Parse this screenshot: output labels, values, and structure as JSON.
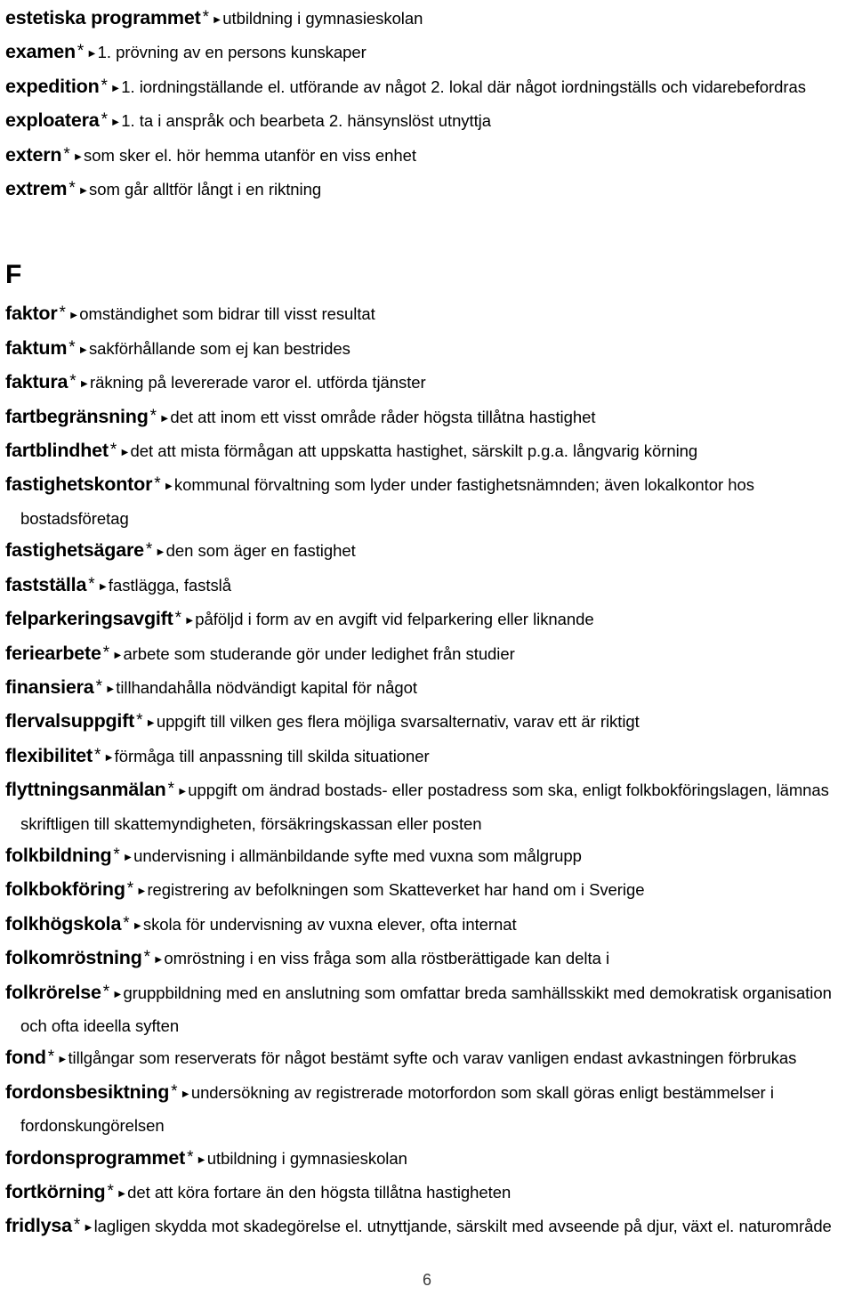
{
  "document": {
    "type": "glossary-page",
    "language": "sv",
    "page_number": "6",
    "marker_star": "*",
    "marker_triangle": "►"
  },
  "entries_before_section": [
    {
      "headword": "estetiska programmet",
      "definition": "utbildning i gymnasieskolan"
    },
    {
      "headword": "examen",
      "definition": "1. prövning av en persons kunskaper"
    },
    {
      "headword": "expedition",
      "definition": "1. iordningställande el. utförande av något 2. lokal där något iordningställs och vidarebefordras"
    },
    {
      "headword": "exploatera",
      "definition": "1. ta i anspråk och bearbeta 2. hänsynslöst utnyttja"
    },
    {
      "headword": "extern",
      "definition": "som sker el. hör hemma utanför en viss enhet"
    },
    {
      "headword": "extrem",
      "definition": "som går alltför långt i en riktning"
    }
  ],
  "section": {
    "letter": "F"
  },
  "entries_after_section": [
    {
      "headword": "faktor",
      "definition": "omständighet som bidrar till visst resultat"
    },
    {
      "headword": "faktum",
      "definition": "sakförhållande som ej kan bestrides"
    },
    {
      "headword": "faktura",
      "definition": "räkning på levererade varor el. utförda tjänster"
    },
    {
      "headword": "fartbegränsning",
      "definition": "det att inom ett visst område råder högsta tillåtna hastighet"
    },
    {
      "headword": "fartblindhet",
      "definition": "det att mista förmågan att uppskatta hastighet, särskilt p.g.a. långvarig körning"
    },
    {
      "headword": "fastighetskontor",
      "definition": "kommunal förvaltning som lyder under fastighetsnämnden; även lokalkontor hos bostadsföretag"
    },
    {
      "headword": "fastighetsägare",
      "definition": "den som äger en fastighet"
    },
    {
      "headword": "fastställa",
      "definition": "fastlägga, fastslå"
    },
    {
      "headword": "felparkeringsavgift",
      "definition": "påföljd i form av en avgift vid felparkering eller liknande"
    },
    {
      "headword": "feriearbete",
      "definition": "arbete som studerande gör under ledighet från studier"
    },
    {
      "headword": "finansiera",
      "definition": "tillhandahålla nödvändigt kapital för något"
    },
    {
      "headword": "flervalsuppgift",
      "definition": "uppgift till vilken ges flera möjliga svarsalternativ, varav ett är riktigt"
    },
    {
      "headword": "flexibilitet",
      "definition": "förmåga till anpassning till skilda situationer"
    },
    {
      "headword": "flyttningsanmälan",
      "definition": "uppgift om ändrad bostads- eller postadress som ska, enligt folkbokföringslagen, lämnas skriftligen till skattemyndigheten, försäkringskassan eller posten"
    },
    {
      "headword": "folkbildning",
      "definition": "undervisning i allmänbildande syfte med vuxna som  målgrupp"
    },
    {
      "headword": "folkbokföring",
      "definition": "registrering av befolkningen som Skatteverket har hand om i Sverige"
    },
    {
      "headword": "folkhögskola",
      "definition": "skola för undervisning av vuxna elever, ofta internat"
    },
    {
      "headword": "folkomröstning",
      "definition": "omröstning i en viss fråga som alla röstberättigade kan delta i"
    },
    {
      "headword": "folkrörelse",
      "definition": "gruppbildning med en anslutning som omfattar breda samhällsskikt med demokratisk organisation och ofta ideella syften"
    },
    {
      "headword": "fond",
      "definition": "tillgångar som reserverats för något bestämt syfte och varav vanligen endast avkastningen förbrukas"
    },
    {
      "headword": "fordonsbesiktning",
      "definition": "undersökning av registrerade motorfordon som skall göras enligt bestämmelser i fordonskungörelsen"
    },
    {
      "headword": "fordonsprogrammet",
      "definition": "utbildning i gymnasieskolan"
    },
    {
      "headword": "fortkörning",
      "definition": "det att köra fortare än den högsta tillåtna hastigheten"
    },
    {
      "headword": "fridlysa",
      "definition": "lagligen skydda mot skadegörelse el. utnyttjande, särskilt med avseende på djur, växt el. naturområde"
    }
  ]
}
